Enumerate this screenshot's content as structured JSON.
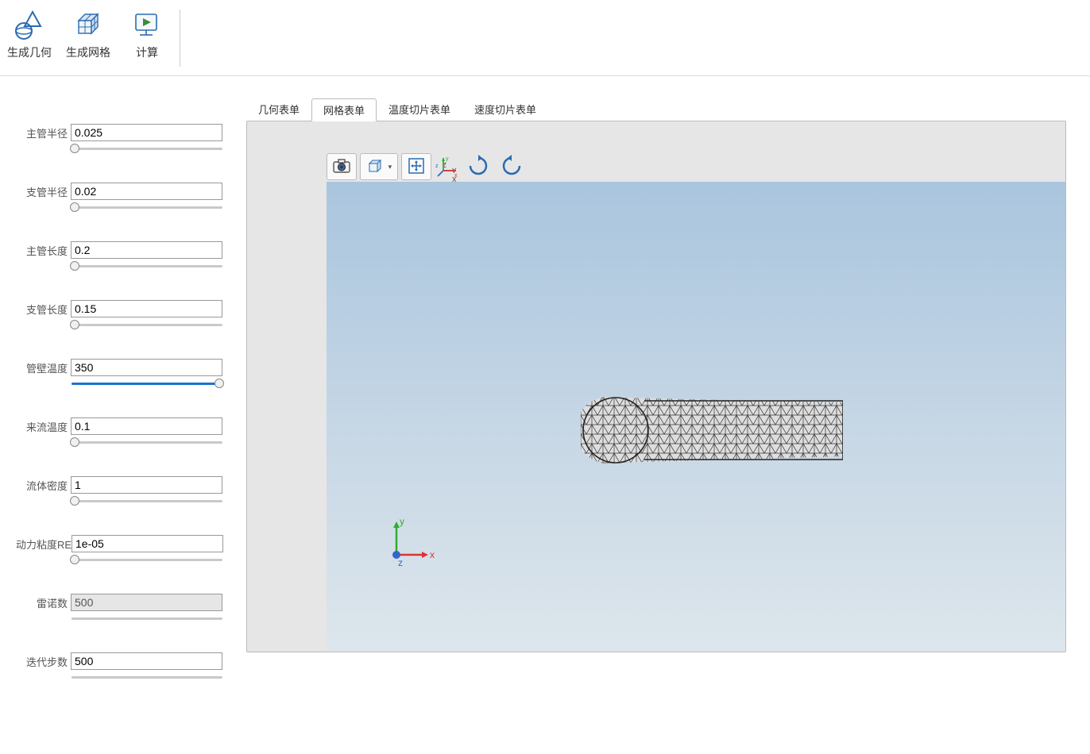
{
  "toolbar": {
    "geom_label": "生成几何",
    "mesh_label": "生成网格",
    "compute_label": "计算"
  },
  "params": [
    {
      "label": "主管半径",
      "value": "0.025",
      "readonly": false,
      "slider_pct": 2
    },
    {
      "label": "支管半径",
      "value": "0.02",
      "readonly": false,
      "slider_pct": 2
    },
    {
      "label": "主管长度",
      "value": "0.2",
      "readonly": false,
      "slider_pct": 2
    },
    {
      "label": "支管长度",
      "value": "0.15",
      "readonly": false,
      "slider_pct": 2
    },
    {
      "label": "管壁温度",
      "value": "350",
      "readonly": false,
      "slider_pct": 98
    },
    {
      "label": "来流温度",
      "value": "0.1",
      "readonly": false,
      "slider_pct": 2
    },
    {
      "label": "流体密度",
      "value": "1",
      "readonly": false,
      "slider_pct": 2
    },
    {
      "label": "动力粘度RE",
      "value": "1e-05",
      "readonly": false,
      "slider_pct": 2
    },
    {
      "label": "雷诺数",
      "value": "500",
      "readonly": true,
      "slider_pct": null
    },
    {
      "label": "迭代步数",
      "value": "500",
      "readonly": false,
      "slider_pct": null
    }
  ],
  "tabs": [
    {
      "label": "几何表单",
      "active": false
    },
    {
      "label": "网格表单",
      "active": true
    },
    {
      "label": "温度切片表单",
      "active": false
    },
    {
      "label": "速度切片表单",
      "active": false
    }
  ],
  "axes": {
    "x": "x",
    "y": "y",
    "z": "z"
  },
  "triad_labels": {
    "x": "X",
    "y": "Y",
    "z": "Z"
  }
}
